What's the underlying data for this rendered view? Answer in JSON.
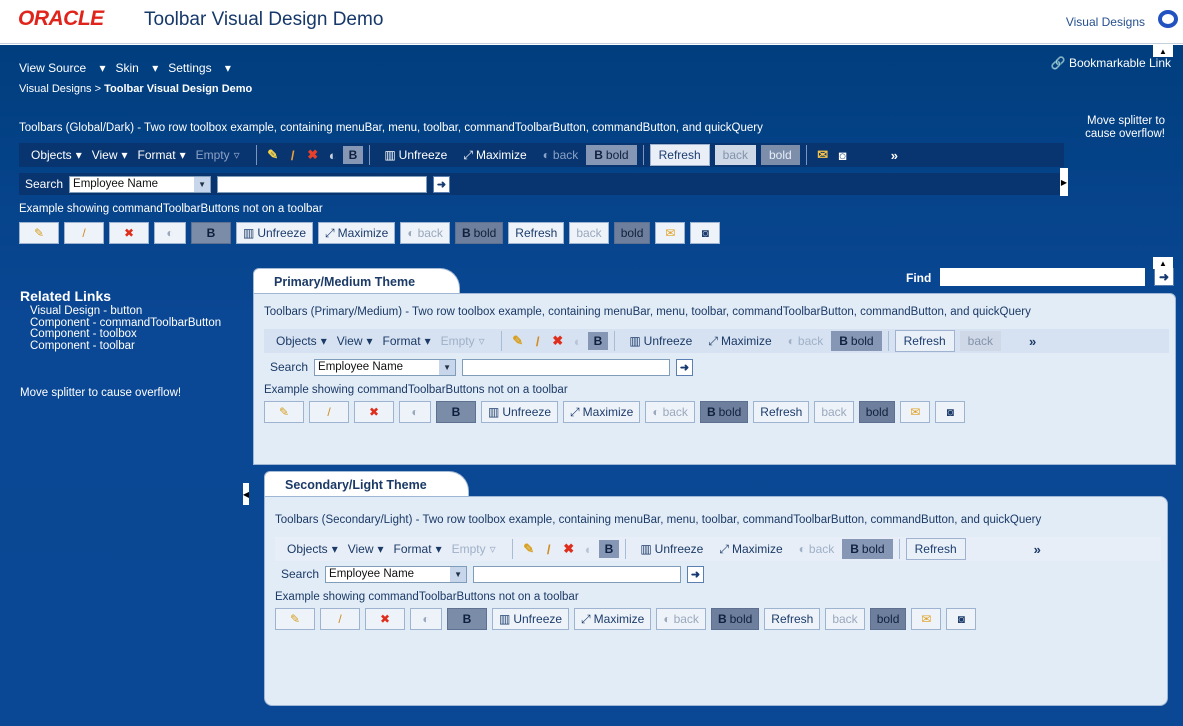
{
  "header": {
    "logo": "ORACLE",
    "title": "Toolbar Visual Design Demo",
    "visual_designs_link": "Visual Designs"
  },
  "nav": {
    "menus": [
      "View Source",
      "Skin",
      "Settings"
    ],
    "breadcrumb_parent": "Visual Designs",
    "breadcrumb_sep": ">",
    "breadcrumb_current": "Toolbar Visual Design Demo",
    "bookmark": "Bookmarkable Link"
  },
  "splitter_msg": "Move splitter to cause overflow!",
  "dark": {
    "caption": "Toolbars (Global/Dark) - Two row toolbox example, containing menuBar, menu, toolbar, commandToolbarButton, commandButton, and quickQuery",
    "caption2": "Example showing commandToolbarButtons not on a toolbar"
  },
  "primary": {
    "tab": "Primary/Medium Theme",
    "caption": "Toolbars (Primary/Medium) - Two row toolbox example, containing menuBar, menu, toolbar, commandToolbarButton, commandButton, and quickQuery",
    "caption2": "Example showing commandToolbarButtons not on a toolbar"
  },
  "secondary": {
    "tab": "Secondary/Light Theme",
    "caption": "Toolbars (Secondary/Light) - Two row toolbox example, containing menuBar, menu, toolbar, commandToolbarButton, commandButton, and quickQuery",
    "caption2": "Example showing commandToolbarButtons not on a toolbar"
  },
  "toolbar": {
    "objects": "Objects",
    "view": "View",
    "format": "Format",
    "empty": "Empty",
    "bold_glyph": "B",
    "unfreeze": "Unfreeze",
    "maximize": "Maximize",
    "back": "back",
    "bold": "bold",
    "refresh": "Refresh",
    "overflow": "»"
  },
  "search": {
    "label": "Search",
    "selected": "Employee Name"
  },
  "related": {
    "title": "Related Links",
    "items": [
      "Visual Design - button",
      "Component - commandToolbarButton",
      "Component - toolbox",
      "Component - toolbar"
    ],
    "message": "Move splitter to cause overflow!"
  },
  "find": {
    "label": "Find"
  }
}
